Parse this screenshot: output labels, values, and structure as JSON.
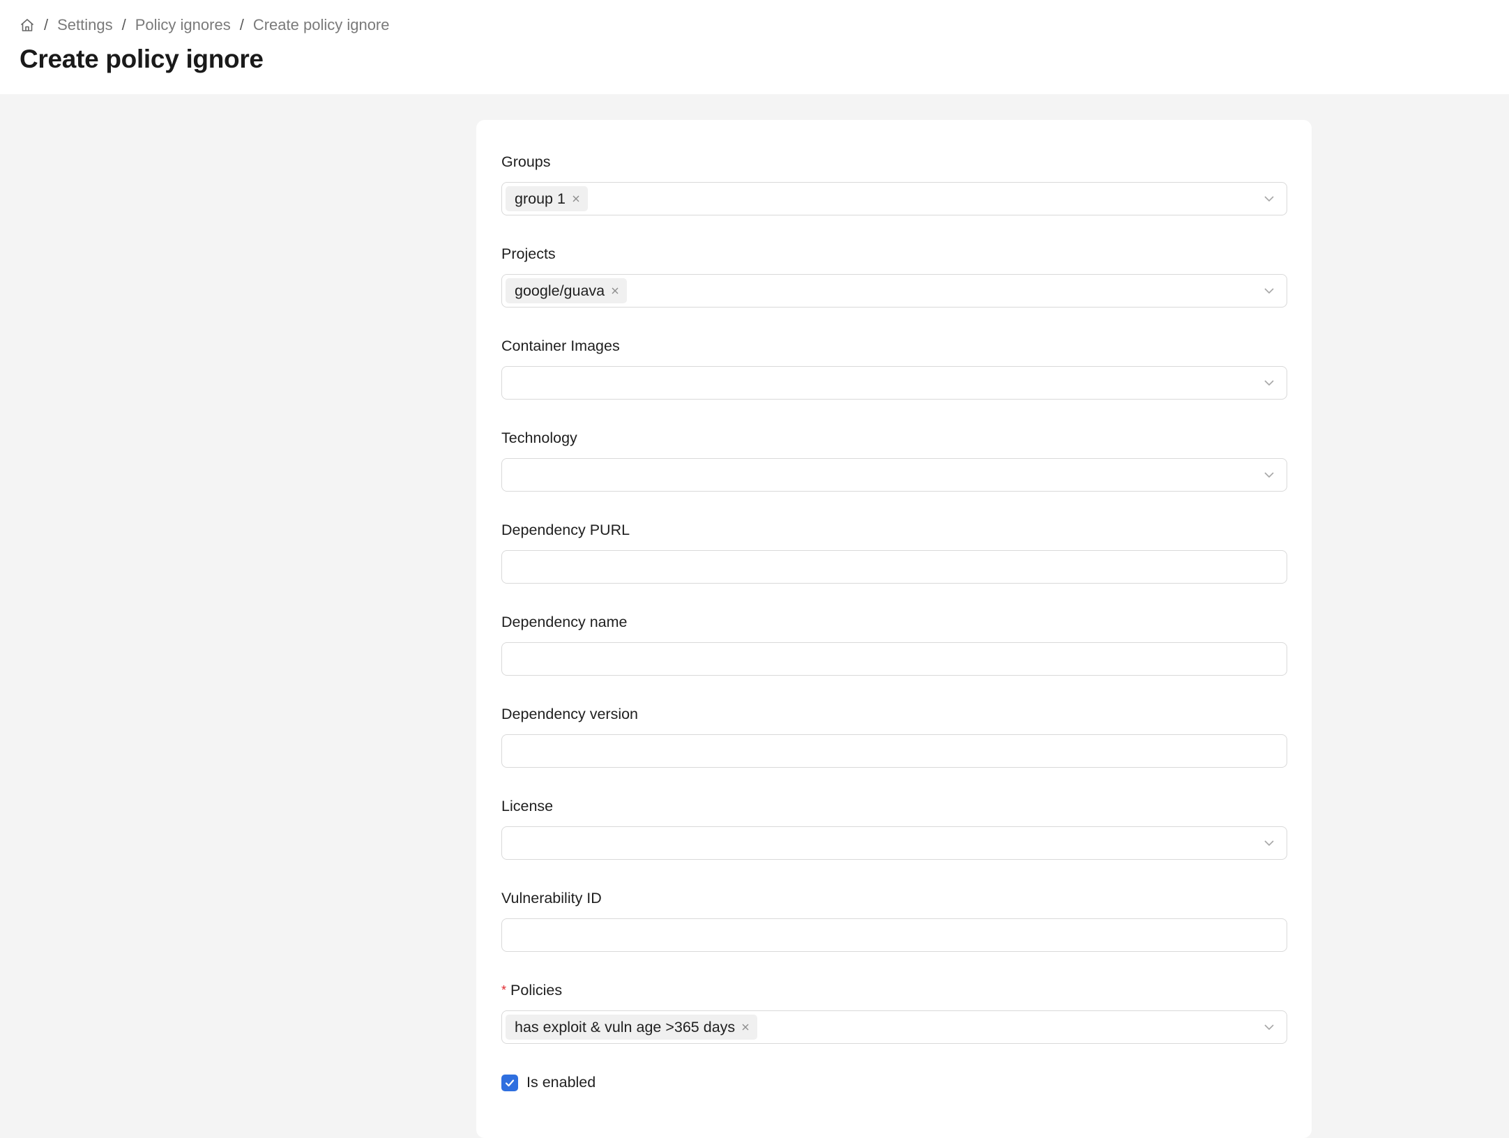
{
  "breadcrumb": {
    "home_icon": "home-icon",
    "items": [
      "Settings",
      "Policy ignores",
      "Create policy ignore"
    ],
    "separator": "/"
  },
  "page_title": "Create policy ignore",
  "form": {
    "groups": {
      "label": "Groups",
      "tags": [
        "group 1"
      ]
    },
    "projects": {
      "label": "Projects",
      "tags": [
        "google/guava"
      ]
    },
    "container_images": {
      "label": "Container Images",
      "value": ""
    },
    "technology": {
      "label": "Technology",
      "value": ""
    },
    "dependency_purl": {
      "label": "Dependency PURL",
      "value": ""
    },
    "dependency_name": {
      "label": "Dependency name",
      "value": ""
    },
    "dependency_version": {
      "label": "Dependency version",
      "value": ""
    },
    "license": {
      "label": "License",
      "value": ""
    },
    "vulnerability_id": {
      "label": "Vulnerability ID",
      "value": ""
    },
    "policies": {
      "label": "Policies",
      "required_mark": "*",
      "tags": [
        "has exploit & vuln age >365 days"
      ]
    },
    "is_enabled": {
      "label": "Is enabled",
      "checked": true
    }
  },
  "colors": {
    "accent": "#2f6fdf",
    "required": "#e0282e",
    "background": "#f4f4f4",
    "tag_bg": "#f0f0f0"
  }
}
